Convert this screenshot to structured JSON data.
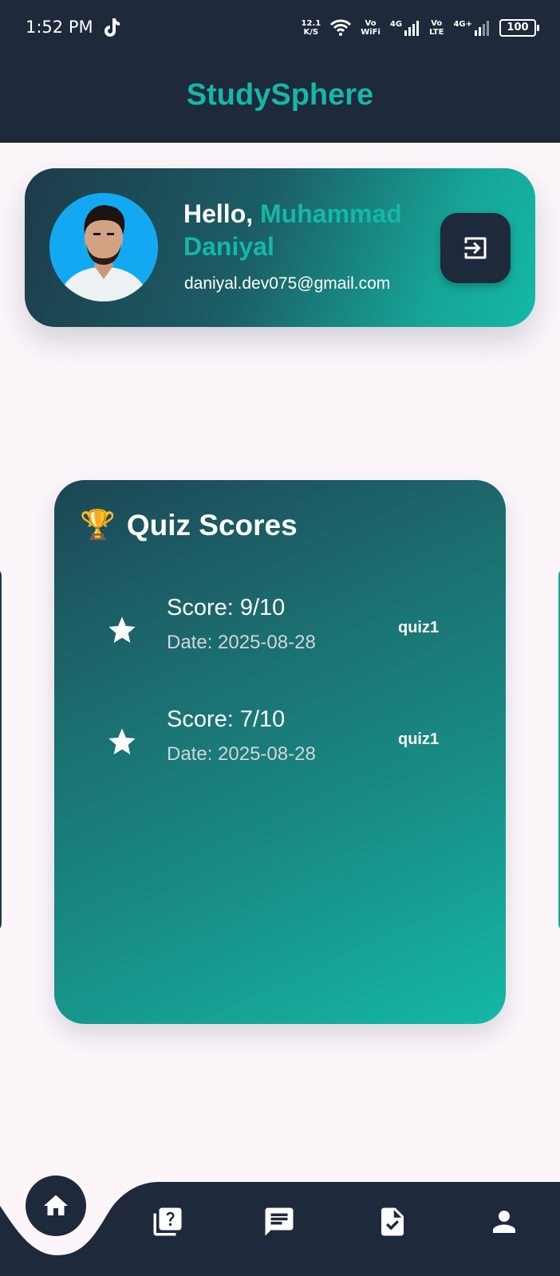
{
  "status_bar": {
    "time": "1:52 PM",
    "net_speed_value": "12.1",
    "net_speed_unit": "K/S",
    "vo_wifi": [
      "Vo",
      "WiFi"
    ],
    "signal1_label": "4G",
    "vo_lte": [
      "Vo",
      "LTE"
    ],
    "signal2_label": "4G+",
    "battery": "100"
  },
  "app_bar": {
    "title": "StudySphere"
  },
  "profile": {
    "greeting": "Hello,",
    "name": "Muhammad Daniyal",
    "email": "daniyal.dev075@gmail.com",
    "logout_icon": "logout-icon"
  },
  "quiz_scores": {
    "icon": "🏆",
    "title": "Quiz Scores",
    "items": [
      {
        "score": "Score: 9/10",
        "date": "Date: 2025-08-28",
        "quiz": "quiz1"
      },
      {
        "score": "Score: 7/10",
        "date": "Date: 2025-08-28",
        "quiz": "quiz1"
      }
    ]
  },
  "nav": {
    "items": [
      "home-icon",
      "quiz-icon",
      "chat-icon",
      "task-icon",
      "profile-icon"
    ],
    "active": "home"
  },
  "colors": {
    "dark": "#1E293B",
    "accent": "#14B8A6",
    "background": "#FCF6FB"
  }
}
